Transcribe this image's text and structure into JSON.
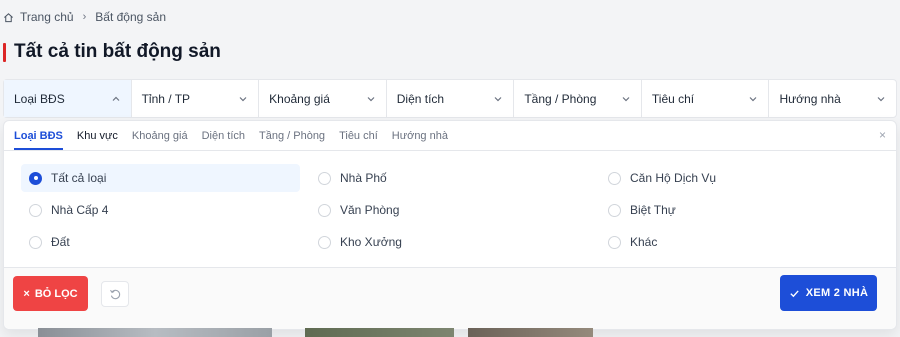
{
  "breadcrumb": {
    "home_icon": "home-icon",
    "home": "Trang chủ",
    "separator": "›",
    "current": "Bất động sản"
  },
  "page": {
    "title": "Tất cả tin bất động sản",
    "accent": "#dc2626"
  },
  "filters": [
    {
      "label": "Loại BĐS",
      "icon": "chevron-up-icon"
    },
    {
      "label": "Tỉnh / TP",
      "icon": "chevron-down-icon"
    },
    {
      "label": "Khoảng giá",
      "icon": "chevron-down-icon"
    },
    {
      "label": "Diện tích",
      "icon": "chevron-down-icon"
    },
    {
      "label": "Tầng / Phòng",
      "icon": "chevron-down-icon"
    },
    {
      "label": "Tiêu chí",
      "icon": "chevron-down-icon"
    },
    {
      "label": "Hướng nhà",
      "icon": "chevron-down-icon"
    }
  ],
  "panel": {
    "tabs": [
      "Loại BĐS",
      "Khu vực",
      "Khoảng giá",
      "Diện tích",
      "Tầng / Phòng",
      "Tiêu chí",
      "Hướng nhà"
    ],
    "close": "×",
    "options": [
      "Tất cả loại",
      "Nhà Phố",
      "Căn Hộ Dịch Vụ",
      "Nhà Cấp 4",
      "Văn Phòng",
      "Biệt Thự",
      "Đất",
      "Kho Xưởng",
      "Khác"
    ],
    "selected_option": "Tất cả loại",
    "clear_icon": "×",
    "clear_label": "BỎ LỌC",
    "reset_icon": "reset-icon",
    "view_icon": "check-icon",
    "view_label": "XEM 2 NHÀ"
  },
  "colors": {
    "primary": "#1d4ed8",
    "danger": "#ef4444"
  }
}
